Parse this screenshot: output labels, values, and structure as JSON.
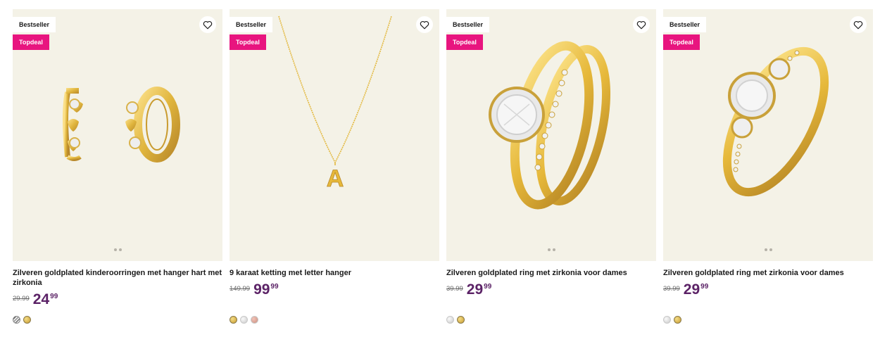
{
  "products": [
    {
      "badge_bestseller": "Bestseller",
      "badge_deal": "Topdeal",
      "title": "Zilveren goldplated kinderoorringen met hanger hart met zirkonia",
      "old_price": "29.99",
      "price_int": "24",
      "price_dec": "99",
      "image_icon": "earrings-icon",
      "swatches": [
        "mixed",
        "gold"
      ]
    },
    {
      "badge_bestseller": "Bestseller",
      "badge_deal": "Topdeal",
      "title": "9 karaat ketting met letter hanger",
      "old_price": "149.99",
      "price_int": "99",
      "price_dec": "99",
      "image_icon": "necklace-icon",
      "swatches": [
        "gold",
        "silver",
        "rose"
      ]
    },
    {
      "badge_bestseller": "Bestseller",
      "badge_deal": "Topdeal",
      "title": "Zilveren goldplated ring met zirkonia voor dames",
      "old_price": "39.99",
      "price_int": "29",
      "price_dec": "99",
      "image_icon": "ring-set-icon",
      "swatches": [
        "silver",
        "gold"
      ]
    },
    {
      "badge_bestseller": "Bestseller",
      "badge_deal": "Topdeal",
      "title": "Zilveren goldplated ring met zirkonia voor dames",
      "old_price": "39.99",
      "price_int": "29",
      "price_dec": "99",
      "image_icon": "ring-icon",
      "swatches": [
        "silver",
        "gold"
      ]
    }
  ],
  "colors": {
    "deal_badge": "#e8157f",
    "price": "#5b2266",
    "image_bg": "#f4f2e7"
  }
}
